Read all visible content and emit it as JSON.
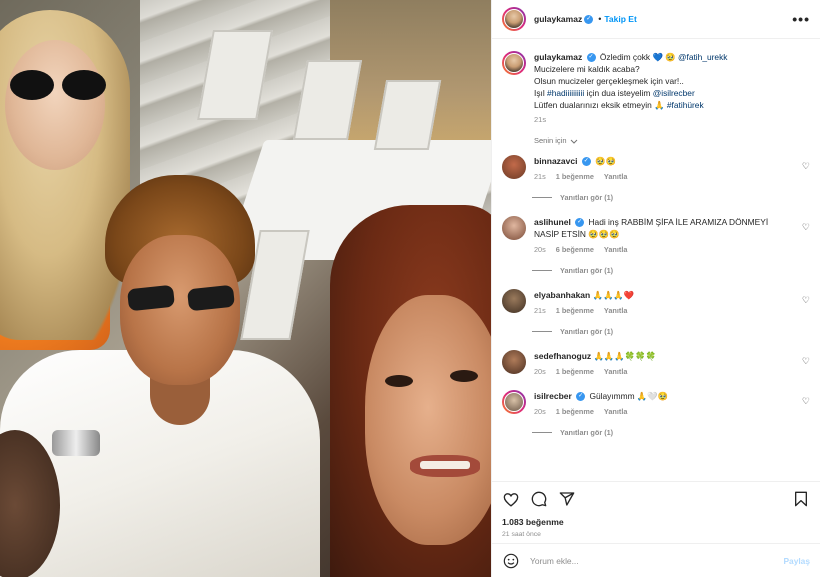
{
  "post": {
    "author": "gulaykamaz",
    "follow_label": "Takip Et",
    "more_label": "•••",
    "caption": {
      "author": "gulaykamaz",
      "line1": "Özledim çokk",
      "line1_emoji": "💙",
      "line1_emoji2": "🥹",
      "mention1": "@fatih_urekk",
      "line2": "Mucizelere mi kaldık acaba?",
      "line3": "Olsun mucizeler gerçekleşmek için var!..",
      "line4_pre": "Işıl",
      "hashtag1": "#hadiiiiiiiiii",
      "line4_mid": "için dua isteyelim",
      "mention2": "@isilrecber",
      "line5_pre": "Lütfen dualarınızı eksik etmeyin",
      "line5_emoji": "🙏",
      "hashtag2": "#fatihürek",
      "time": "21s"
    },
    "for_you_label": "Senin için",
    "comments": [
      {
        "user": "binnazavci",
        "verified": true,
        "text": "🥹🥹",
        "time": "21s",
        "likes": "1 beğenme",
        "reply_label": "Yanıtla",
        "replies_label": "Yanıtları gör (1)"
      },
      {
        "user": "aslihunel",
        "verified": true,
        "text": "Hadi inş RABBİM ŞİFA İLE ARAMIZA DÖNMEYİ NASİP ETSİN 🥹🥹🥹",
        "time": "20s",
        "likes": "6 beğenme",
        "reply_label": "Yanıtla",
        "replies_label": "Yanıtları gör (1)"
      },
      {
        "user": "elyabanhakan",
        "verified": false,
        "text": "🙏🙏🙏❤️",
        "time": "21s",
        "likes": "1 beğenme",
        "reply_label": "Yanıtla",
        "replies_label": "Yanıtları gör (1)"
      },
      {
        "user": "sedefhanoguz",
        "verified": false,
        "text": "🙏🙏🙏🍀🍀🍀",
        "time": "20s",
        "likes": "1 beğenme",
        "reply_label": "Yanıtla"
      },
      {
        "user": "isilrecber",
        "verified": true,
        "text": "Gülayımmm 🙏🤍🥹",
        "time": "20s",
        "likes": "1 beğenme",
        "reply_label": "Yanıtla",
        "replies_label": "Yanıtları gör (1)"
      }
    ],
    "likes_count": "1.083 beğenme",
    "posted_ago": "21 saat önce",
    "comment_placeholder": "Yorum ekle...",
    "post_label": "Paylaş",
    "colors": {
      "link": "#00376b",
      "accent": "#0095f6",
      "verified": "#3897f0",
      "post_disabled": "#b3dbff",
      "muted": "#8e8e8e"
    },
    "icons": [
      "heart-icon",
      "comment-icon",
      "share-icon",
      "bookmark-icon",
      "emoji-icon",
      "more-icon",
      "verified-icon",
      "chevron-down-icon"
    ]
  }
}
